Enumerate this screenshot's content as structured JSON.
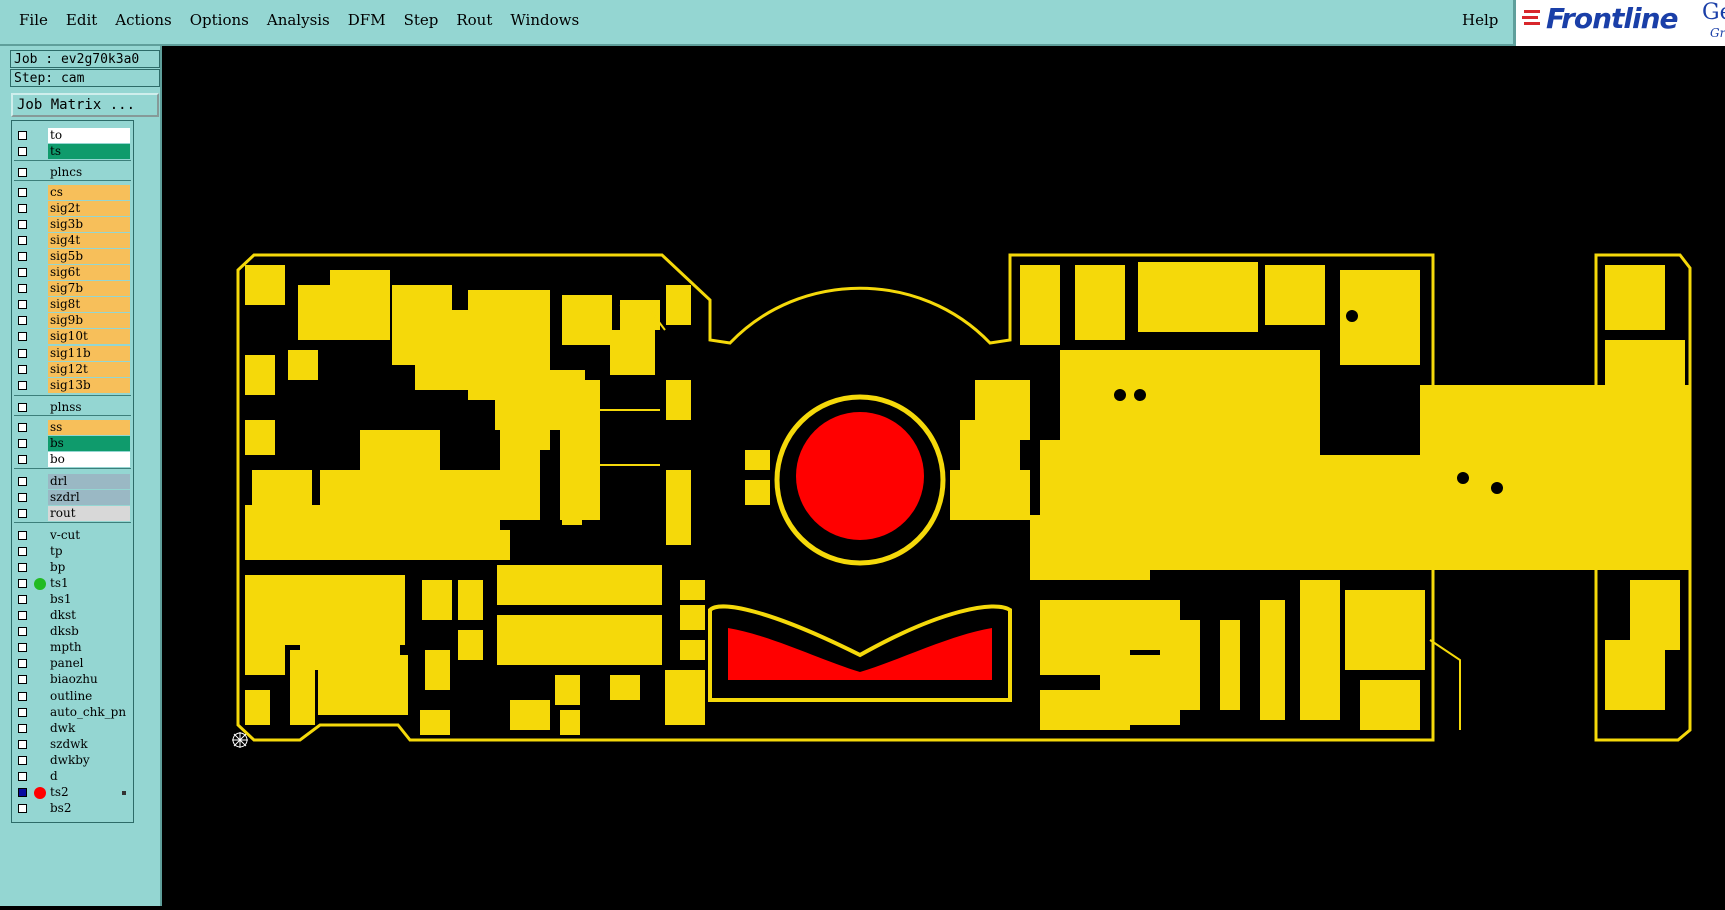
{
  "menu": [
    "File",
    "Edit",
    "Actions",
    "Options",
    "Analysis",
    "DFM",
    "Step",
    "Rout",
    "Windows"
  ],
  "help": "Help",
  "brand": {
    "name": "Frontline",
    "ext": "Gen",
    "sub": "Gro"
  },
  "job": "Job : ev2g70k3a0",
  "step": "Step: cam",
  "matrix_button": "Job Matrix ...",
  "colors": {
    "panel": "#94d6d2",
    "copper": "#f5d90a",
    "drill": "#ff0000",
    "signal": "#f7bf5a",
    "mask": "#0f9b6c",
    "drl": "#9ab8c4"
  },
  "layers": [
    {
      "name": "to",
      "color": "#ffffff"
    },
    {
      "name": "ts",
      "color": "#0f9b6c"
    },
    {
      "name": "plncs",
      "color": "#94d6d2"
    },
    {
      "name": "cs",
      "color": "#f7bf5a"
    },
    {
      "name": "sig2t",
      "color": "#f7bf5a"
    },
    {
      "name": "sig3b",
      "color": "#f7bf5a"
    },
    {
      "name": "sig4t",
      "color": "#f7bf5a"
    },
    {
      "name": "sig5b",
      "color": "#f7bf5a"
    },
    {
      "name": "sig6t",
      "color": "#f7bf5a"
    },
    {
      "name": "sig7b",
      "color": "#f7bf5a"
    },
    {
      "name": "sig8t",
      "color": "#f7bf5a"
    },
    {
      "name": "sig9b",
      "color": "#f7bf5a"
    },
    {
      "name": "sig10t",
      "color": "#f7bf5a"
    },
    {
      "name": "sig11b",
      "color": "#f7bf5a"
    },
    {
      "name": "sig12t",
      "color": "#f7bf5a"
    },
    {
      "name": "sig13b",
      "color": "#f7bf5a"
    },
    {
      "name": "plnss",
      "color": "#94d6d2"
    },
    {
      "name": "ss",
      "color": "#f7bf5a"
    },
    {
      "name": "bs",
      "color": "#0f9b6c"
    },
    {
      "name": "bo",
      "color": "#ffffff"
    },
    {
      "name": "drl",
      "color": "#9ab8c4"
    },
    {
      "name": "szdrl",
      "color": "#9ab8c4"
    },
    {
      "name": "rout",
      "color": "#d8d8d8"
    },
    {
      "name": "v-cut",
      "color": "#94d6d2"
    },
    {
      "name": "tp",
      "color": "#94d6d2"
    },
    {
      "name": "bp",
      "color": "#94d6d2"
    },
    {
      "name": "ts1",
      "color": "#94d6d2",
      "dot": "#22bb22"
    },
    {
      "name": "bs1",
      "color": "#94d6d2"
    },
    {
      "name": "dkst",
      "color": "#94d6d2"
    },
    {
      "name": "dksb",
      "color": "#94d6d2"
    },
    {
      "name": "mpth",
      "color": "#94d6d2"
    },
    {
      "name": "panel",
      "color": "#94d6d2"
    },
    {
      "name": "biaozhu",
      "color": "#94d6d2"
    },
    {
      "name": "outline",
      "color": "#94d6d2"
    },
    {
      "name": "auto_chk_pn",
      "color": "#94d6d2"
    },
    {
      "name": "dwk",
      "color": "#94d6d2"
    },
    {
      "name": "szdwk",
      "color": "#94d6d2"
    },
    {
      "name": "dwkby",
      "color": "#94d6d2"
    },
    {
      "name": "d",
      "color": "#94d6d2"
    },
    {
      "name": "ts2",
      "color": "#94d6d2",
      "dot": "#ff0000",
      "checked": true
    },
    {
      "name": "bs2",
      "color": "#94d6d2"
    }
  ]
}
